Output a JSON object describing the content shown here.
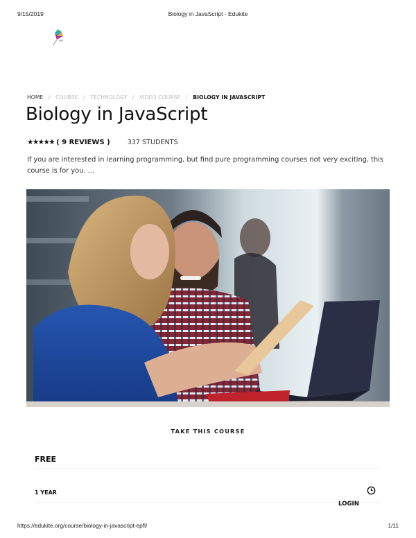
{
  "print_header": {
    "date": "9/15/2019",
    "title": "Biology in JavaScript - Edukite"
  },
  "logo": {
    "icon": "kite-logo-icon",
    "label": "Edukite"
  },
  "breadcrumb": [
    {
      "label": "HOME",
      "state": "link"
    },
    {
      "label": "COURSE",
      "state": "muted"
    },
    {
      "label": "TECHNOLOGY",
      "state": "muted"
    },
    {
      "label": "VIDEO COURSE",
      "state": "muted"
    },
    {
      "label": "BIOLOGY IN JAVASCRIPT",
      "state": "current"
    }
  ],
  "breadcrumb_separator": "/",
  "course": {
    "title": "Biology in JavaScript",
    "rating_stars": "★★★★★",
    "rating": 5,
    "rating_max": 5,
    "reviews_label": "( 9 REVIEWS )",
    "students_label": "337 STUDENTS",
    "description": "If you are interested in learning programming, but find pure programming courses not very exciting, this course is for you. ..."
  },
  "hero_image": {
    "alt": "Two people smiling while using a tablet and laptop in an office",
    "palette": {
      "background": "#6f7a86",
      "window_light": "#e6eef1",
      "shirt_blue": "#1f4aa0",
      "hair_blonde": "#c9a470",
      "skin": "#e2b59a",
      "plaid_red": "#9b2b35",
      "laptop": "#2a2f45",
      "tablet": "#e8c79a",
      "desk_red": "#c0222c"
    }
  },
  "enroll": {
    "section_title": "TAKE THIS COURSE",
    "price": "FREE",
    "duration": "1 YEAR",
    "duration_icon": "clock-icon",
    "login_label": "LOGIN"
  },
  "print_footer": {
    "url": "https://edukite.org/course/biology-in-javascript-epfl/",
    "page": "1/11"
  }
}
